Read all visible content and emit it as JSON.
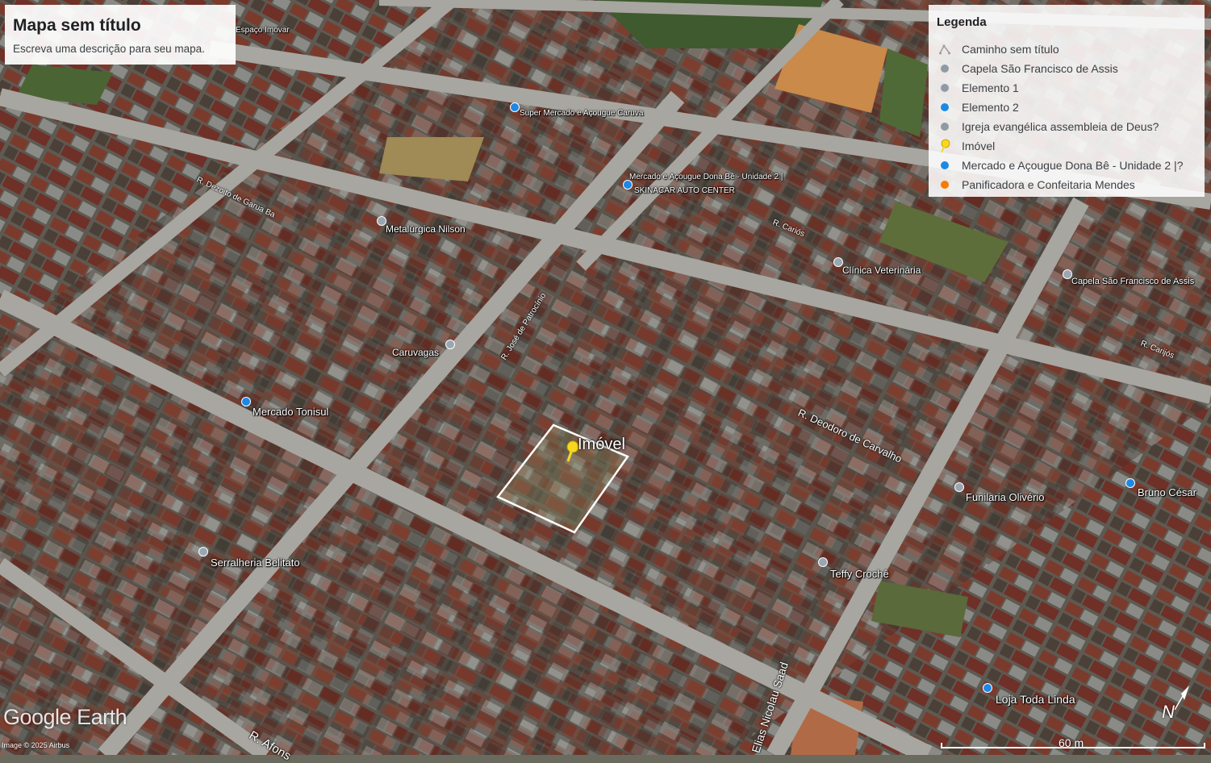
{
  "map": {
    "title": "Mapa sem título",
    "description": "Escreva uma descrição para seu mapa.",
    "focus_label": "Imóvel"
  },
  "legend": {
    "heading": "Legenda",
    "items": [
      {
        "label": "Caminho sem título",
        "icon": "path-icon",
        "color": "#9e9e9e"
      },
      {
        "label": "Capela São Francisco de Assis",
        "icon": "place-icon",
        "color": "#8e9aa6"
      },
      {
        "label": "Elemento 1",
        "icon": "place-icon",
        "color": "#8e9aa6"
      },
      {
        "label": "Elemento 2",
        "icon": "place-icon",
        "color": "#1e88e5"
      },
      {
        "label": "Igreja evangélica assembleia de Deus?",
        "icon": "place-icon",
        "color": "#8e9aa6"
      },
      {
        "label": "Imóvel",
        "icon": "pushpin-icon",
        "color": "#f9d71c"
      },
      {
        "label": "Mercado e Açougue Dona Bê - Unidade 2 |?",
        "icon": "place-icon",
        "color": "#1e88e5"
      },
      {
        "label": "Panificadora e Confeitaria Mendes",
        "icon": "place-icon",
        "color": "#f57c00"
      }
    ]
  },
  "places": [
    {
      "label": "Espaço Imovar"
    },
    {
      "label": "Super Mercado e Açougue Caruva"
    },
    {
      "label": "Mercado e Açougue Dona Bê - Unidade 2 |"
    },
    {
      "label": "SKINACAR AUTO CENTER"
    },
    {
      "label": "Metalúrgica Nilson"
    },
    {
      "label": "Clínica Veterinária"
    },
    {
      "label": "Capela São Francisco de Assis"
    },
    {
      "label": "Caruvagas"
    },
    {
      "label": "Mercado Tonisul"
    },
    {
      "label": "Funilaria Olivério"
    },
    {
      "label": "Bruno César"
    },
    {
      "label": "Serralheria Belitato"
    },
    {
      "label": "Teffy Crochê"
    },
    {
      "label": "Loja Toda Linda"
    }
  ],
  "streets": [
    {
      "label": "R. Dezoito de Garua Ba"
    },
    {
      "label": "R. Cariós"
    },
    {
      "label": "R. Carijós"
    },
    {
      "label": "R. José de Patrocínio"
    },
    {
      "label": "R. Deodoro de Carvalho"
    },
    {
      "label": "R. Afons"
    },
    {
      "label": "Elias Nicolau Saad"
    }
  ],
  "brand": "Google Earth",
  "credit": "Image © 2025 Airbus",
  "scale_label": "60 m",
  "compass_label": "N"
}
